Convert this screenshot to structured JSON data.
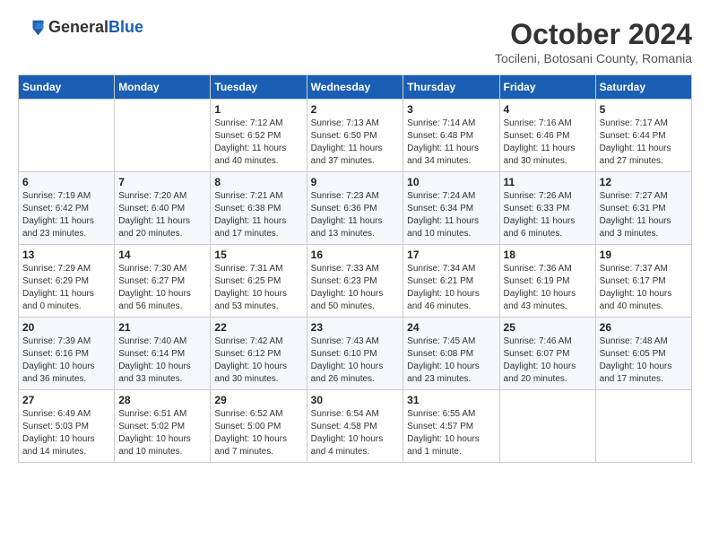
{
  "header": {
    "logo_general": "General",
    "logo_blue": "Blue",
    "month_title": "October 2024",
    "location": "Tocileni, Botosani County, Romania"
  },
  "days_of_week": [
    "Sunday",
    "Monday",
    "Tuesday",
    "Wednesday",
    "Thursday",
    "Friday",
    "Saturday"
  ],
  "weeks": [
    [
      {
        "day": "",
        "info": ""
      },
      {
        "day": "",
        "info": ""
      },
      {
        "day": "1",
        "info": "Sunrise: 7:12 AM\nSunset: 6:52 PM\nDaylight: 11 hours and 40 minutes."
      },
      {
        "day": "2",
        "info": "Sunrise: 7:13 AM\nSunset: 6:50 PM\nDaylight: 11 hours and 37 minutes."
      },
      {
        "day": "3",
        "info": "Sunrise: 7:14 AM\nSunset: 6:48 PM\nDaylight: 11 hours and 34 minutes."
      },
      {
        "day": "4",
        "info": "Sunrise: 7:16 AM\nSunset: 6:46 PM\nDaylight: 11 hours and 30 minutes."
      },
      {
        "day": "5",
        "info": "Sunrise: 7:17 AM\nSunset: 6:44 PM\nDaylight: 11 hours and 27 minutes."
      }
    ],
    [
      {
        "day": "6",
        "info": "Sunrise: 7:19 AM\nSunset: 6:42 PM\nDaylight: 11 hours and 23 minutes."
      },
      {
        "day": "7",
        "info": "Sunrise: 7:20 AM\nSunset: 6:40 PM\nDaylight: 11 hours and 20 minutes."
      },
      {
        "day": "8",
        "info": "Sunrise: 7:21 AM\nSunset: 6:38 PM\nDaylight: 11 hours and 17 minutes."
      },
      {
        "day": "9",
        "info": "Sunrise: 7:23 AM\nSunset: 6:36 PM\nDaylight: 11 hours and 13 minutes."
      },
      {
        "day": "10",
        "info": "Sunrise: 7:24 AM\nSunset: 6:34 PM\nDaylight: 11 hours and 10 minutes."
      },
      {
        "day": "11",
        "info": "Sunrise: 7:26 AM\nSunset: 6:33 PM\nDaylight: 11 hours and 6 minutes."
      },
      {
        "day": "12",
        "info": "Sunrise: 7:27 AM\nSunset: 6:31 PM\nDaylight: 11 hours and 3 minutes."
      }
    ],
    [
      {
        "day": "13",
        "info": "Sunrise: 7:29 AM\nSunset: 6:29 PM\nDaylight: 11 hours and 0 minutes."
      },
      {
        "day": "14",
        "info": "Sunrise: 7:30 AM\nSunset: 6:27 PM\nDaylight: 10 hours and 56 minutes."
      },
      {
        "day": "15",
        "info": "Sunrise: 7:31 AM\nSunset: 6:25 PM\nDaylight: 10 hours and 53 minutes."
      },
      {
        "day": "16",
        "info": "Sunrise: 7:33 AM\nSunset: 6:23 PM\nDaylight: 10 hours and 50 minutes."
      },
      {
        "day": "17",
        "info": "Sunrise: 7:34 AM\nSunset: 6:21 PM\nDaylight: 10 hours and 46 minutes."
      },
      {
        "day": "18",
        "info": "Sunrise: 7:36 AM\nSunset: 6:19 PM\nDaylight: 10 hours and 43 minutes."
      },
      {
        "day": "19",
        "info": "Sunrise: 7:37 AM\nSunset: 6:17 PM\nDaylight: 10 hours and 40 minutes."
      }
    ],
    [
      {
        "day": "20",
        "info": "Sunrise: 7:39 AM\nSunset: 6:16 PM\nDaylight: 10 hours and 36 minutes."
      },
      {
        "day": "21",
        "info": "Sunrise: 7:40 AM\nSunset: 6:14 PM\nDaylight: 10 hours and 33 minutes."
      },
      {
        "day": "22",
        "info": "Sunrise: 7:42 AM\nSunset: 6:12 PM\nDaylight: 10 hours and 30 minutes."
      },
      {
        "day": "23",
        "info": "Sunrise: 7:43 AM\nSunset: 6:10 PM\nDaylight: 10 hours and 26 minutes."
      },
      {
        "day": "24",
        "info": "Sunrise: 7:45 AM\nSunset: 6:08 PM\nDaylight: 10 hours and 23 minutes."
      },
      {
        "day": "25",
        "info": "Sunrise: 7:46 AM\nSunset: 6:07 PM\nDaylight: 10 hours and 20 minutes."
      },
      {
        "day": "26",
        "info": "Sunrise: 7:48 AM\nSunset: 6:05 PM\nDaylight: 10 hours and 17 minutes."
      }
    ],
    [
      {
        "day": "27",
        "info": "Sunrise: 6:49 AM\nSunset: 5:03 PM\nDaylight: 10 hours and 14 minutes."
      },
      {
        "day": "28",
        "info": "Sunrise: 6:51 AM\nSunset: 5:02 PM\nDaylight: 10 hours and 10 minutes."
      },
      {
        "day": "29",
        "info": "Sunrise: 6:52 AM\nSunset: 5:00 PM\nDaylight: 10 hours and 7 minutes."
      },
      {
        "day": "30",
        "info": "Sunrise: 6:54 AM\nSunset: 4:58 PM\nDaylight: 10 hours and 4 minutes."
      },
      {
        "day": "31",
        "info": "Sunrise: 6:55 AM\nSunset: 4:57 PM\nDaylight: 10 hours and 1 minute."
      },
      {
        "day": "",
        "info": ""
      },
      {
        "day": "",
        "info": ""
      }
    ]
  ]
}
